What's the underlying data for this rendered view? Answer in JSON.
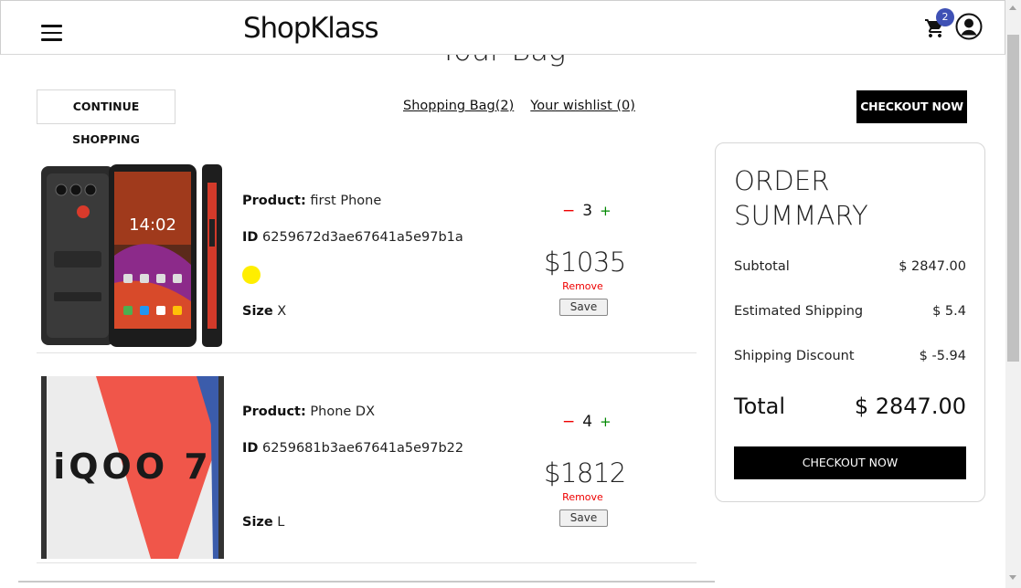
{
  "header": {
    "brand": "ShopKlass",
    "cart_count": "2"
  },
  "page": {
    "title": "Your Bag"
  },
  "actions": {
    "continue_label": "CONTINUE SHOPPING",
    "shopping_bag_link": "Shopping Bag(2)",
    "wishlist_link": "Your wishlist (0)",
    "checkout_top_label": "CHECKOUT NOW"
  },
  "products": [
    {
      "product_label": "Product:",
      "product_name": "first Phone",
      "id_label": "ID",
      "id": "6259672d3ae67641a5e97b1a",
      "color": "#ffee00",
      "size_label": "Size",
      "size": "X",
      "minus": "−",
      "quantity": "3",
      "plus": "+",
      "price": "$1035",
      "remove_label": "Remove",
      "save_label": "Save"
    },
    {
      "product_label": "Product:",
      "product_name": "Phone DX",
      "id_label": "ID",
      "id": "6259681b3ae67641a5e97b22",
      "image_text": "iQOO 7",
      "size_label": "Size",
      "size": "L",
      "minus": "−",
      "quantity": "4",
      "plus": "+",
      "price": "$1812",
      "remove_label": "Remove",
      "save_label": "Save"
    }
  ],
  "summary": {
    "title_line1": "ORDER",
    "title_line2": "SUMMARY",
    "subtotal_label": "Subtotal",
    "subtotal_value": "$ 2847.00",
    "shipping_label": "Estimated Shipping",
    "shipping_value": "$ 5.4",
    "discount_label": "Shipping Discount",
    "discount_value": "$ -5.94",
    "total_label": "Total",
    "total_value": "$ 2847.00",
    "checkout_label": "CHECKOUT NOW"
  },
  "colors": {
    "badge": "#3f51b5",
    "remove": "#ee0000",
    "plus": "#008800",
    "button_dark": "#000000"
  }
}
